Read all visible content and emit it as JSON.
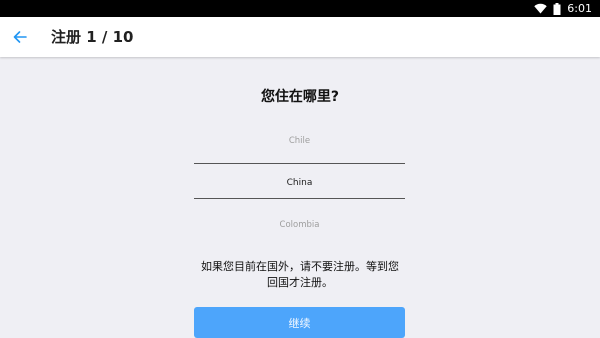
{
  "status_bar": {
    "time": "6:01",
    "icons": [
      "wifi-icon",
      "battery-icon"
    ]
  },
  "app_bar": {
    "back_icon": "arrow-left-icon",
    "title": "注册 1 / 10"
  },
  "main": {
    "question": "您住在哪里?",
    "picker": {
      "options": [
        "Chile",
        "China",
        "Colombia"
      ],
      "selected": "China"
    },
    "notice_line1": "如果您目前在国外，请不要注册。等到您",
    "notice_line2": "回国才注册。",
    "continue_label": "继续"
  },
  "colors": {
    "accent": "#4da5fb",
    "back_arrow": "#2196f3",
    "background": "#efeff4"
  }
}
